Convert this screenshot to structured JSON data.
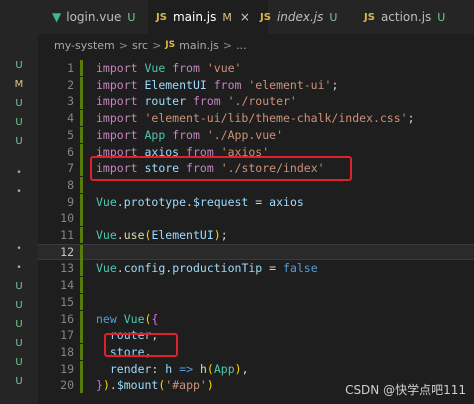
{
  "tabs": [
    {
      "name": "login.vue",
      "badge": "U",
      "icon": "vue-logo-icon",
      "active": false
    },
    {
      "name": "main.js",
      "badge": "M",
      "icon": "js-file-icon",
      "active": true
    },
    {
      "name": "index.js",
      "badge": "U",
      "icon": "js-file-icon",
      "active": false
    },
    {
      "name": "action.js",
      "badge": "U",
      "icon": "js-file-icon",
      "active": false
    }
  ],
  "js_label": "JS",
  "close_glyph": "×",
  "breadcrumb": {
    "parts": [
      "my-system",
      "src",
      "main.js",
      "..."
    ],
    "separator": ">"
  },
  "gutter_markers": [
    "U",
    "M",
    "U",
    "U",
    "U",
    "•",
    "•",
    "•",
    "•",
    "U",
    "U",
    "U",
    "U",
    "U",
    "U"
  ],
  "code_lines": [
    "import Vue from 'vue'",
    "import ElementUI from 'element-ui';",
    "import router from './router'",
    "import 'element-ui/lib/theme-chalk/index.css';",
    "import App from './App.vue'",
    "import axios from 'axios'",
    "import store from './store/index'",
    "",
    "Vue.prototype.$request = axios",
    "",
    "Vue.use(ElementUI);",
    "",
    "Vue.config.productionTip = false",
    "",
    "",
    "new Vue({",
    "  router,",
    "  store,",
    "  render: h => h(App),",
    "}).$mount('#app')"
  ],
  "current_line": 12,
  "watermark": "CSDN @快学点吧111",
  "colors": {
    "keyword": "#c586c0",
    "string": "#ce9178",
    "variable": "#9cdcfe",
    "class": "#4ec9b0",
    "highlight_box": "#e0212b",
    "untracked_badge": "#73c991",
    "modified_badge": "#e2c08d"
  }
}
